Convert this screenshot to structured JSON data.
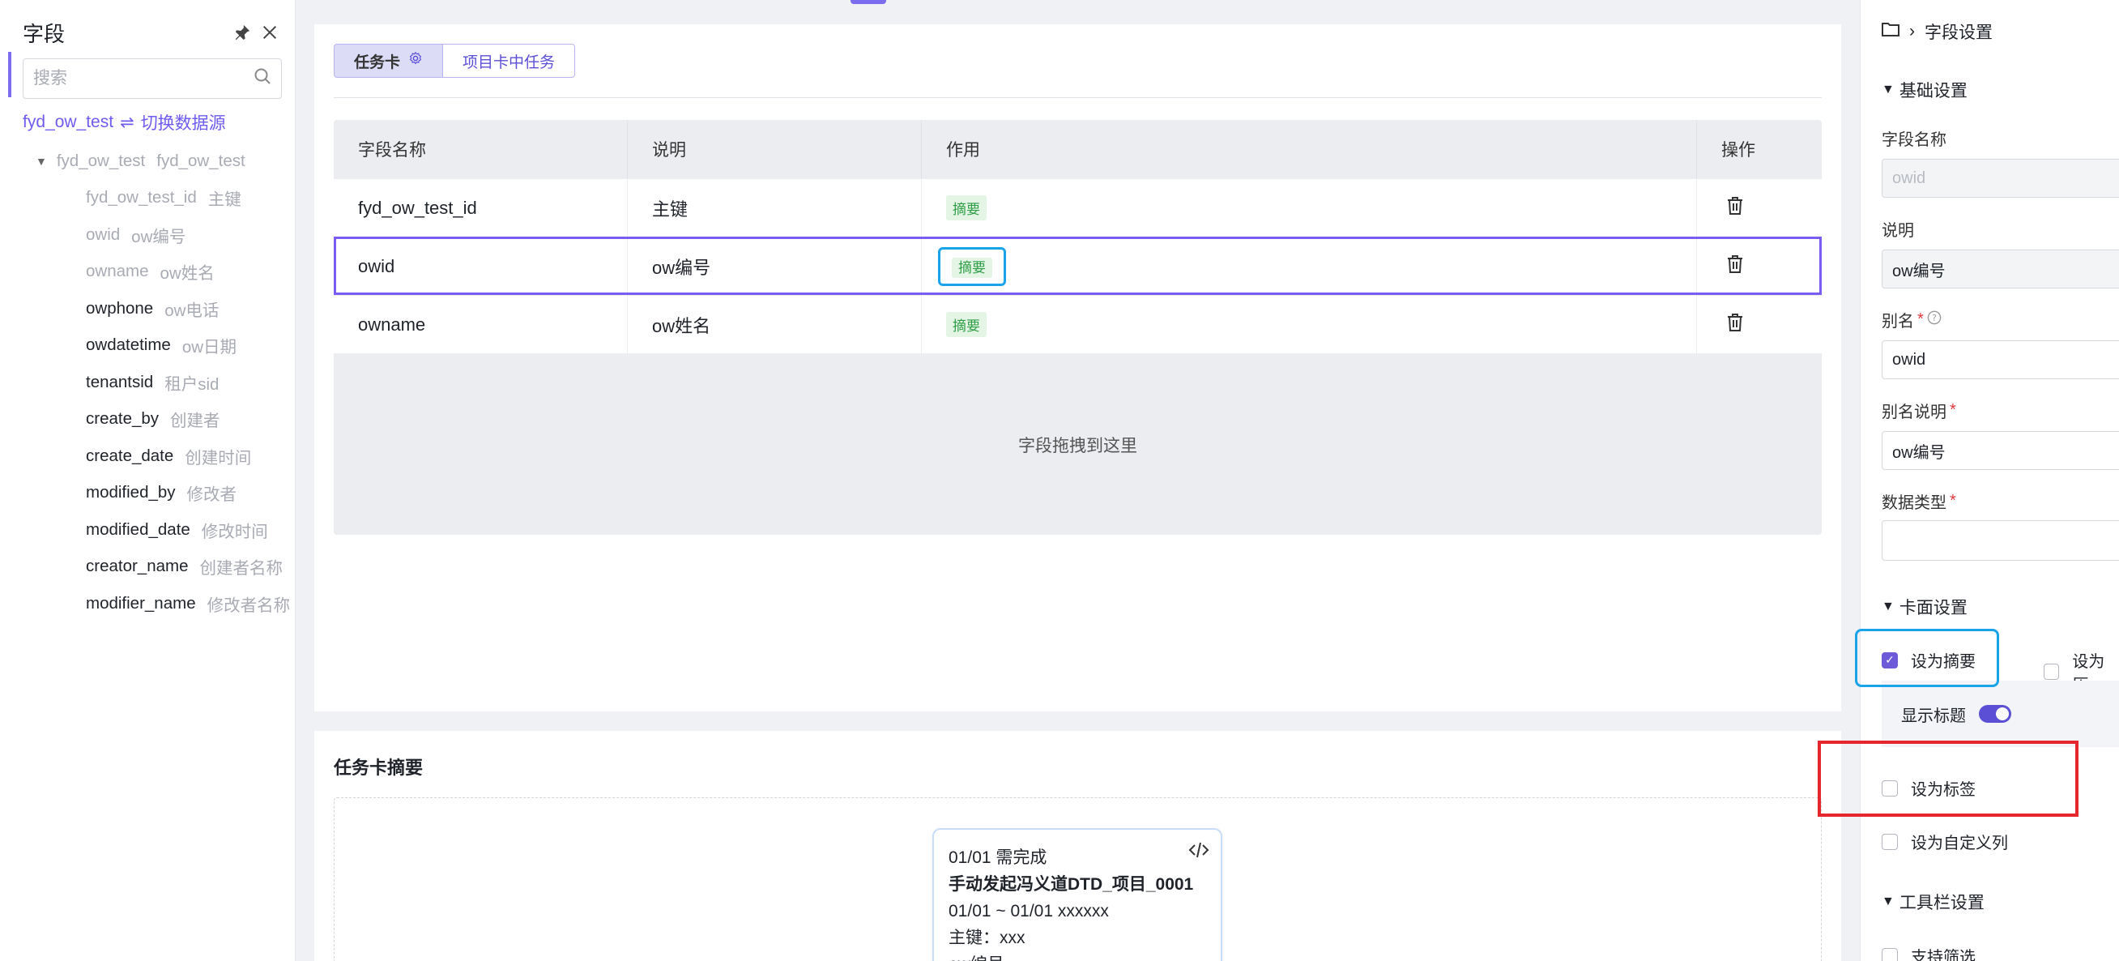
{
  "left_panel": {
    "title": "字段",
    "search_placeholder": "搜索",
    "datasource": {
      "name": "fyd_ow_test",
      "switch_label": "切换数据源"
    },
    "tree": {
      "root": {
        "name": "fyd_ow_test",
        "desc": "fyd_ow_test"
      },
      "items": [
        {
          "name": "fyd_ow_test_id",
          "desc": "主键"
        },
        {
          "name": "owid",
          "desc": "ow编号"
        },
        {
          "name": "owname",
          "desc": "ow姓名"
        },
        {
          "name": "owphone",
          "desc": "ow电话"
        },
        {
          "name": "owdatetime",
          "desc": "ow日期"
        },
        {
          "name": "tenantsid",
          "desc": "租户sid"
        },
        {
          "name": "create_by",
          "desc": "创建者"
        },
        {
          "name": "create_date",
          "desc": "创建时间"
        },
        {
          "name": "modified_by",
          "desc": "修改者"
        },
        {
          "name": "modified_date",
          "desc": "修改时间"
        },
        {
          "name": "creator_name",
          "desc": "创建者名称"
        },
        {
          "name": "modifier_name",
          "desc": "修改者名称"
        }
      ]
    }
  },
  "main": {
    "tabs": [
      {
        "label": "任务卡"
      },
      {
        "label": "项目卡中任务"
      }
    ],
    "table": {
      "headers": [
        "字段名称",
        "说明",
        "作用",
        "操作"
      ],
      "rows": [
        {
          "name": "fyd_ow_test_id",
          "desc": "主键",
          "role": "摘要"
        },
        {
          "name": "owid",
          "desc": "ow编号",
          "role": "摘要"
        },
        {
          "name": "owname",
          "desc": "ow姓名",
          "role": "摘要"
        }
      ],
      "drop_hint": "字段拖拽到这里"
    },
    "summary": {
      "title": "任务卡摘要",
      "preview": {
        "line1": "01/01 需完成",
        "line2": "手动发起冯义道DTD_项目_0001",
        "line3": "01/01 ~ 01/01 xxxxxx",
        "line4": "主键：xxx",
        "line5": "ow编号"
      }
    }
  },
  "right_panel": {
    "breadcrumb": "字段设置",
    "basic_section": "基础设置",
    "field_name_label": "字段名称",
    "field_name_value": "owid",
    "desc_label": "说明",
    "desc_value": "ow编号",
    "alias_label": "别名",
    "alias_value": "owid",
    "alias_desc_label": "别名说明",
    "alias_desc_value": "ow编号",
    "data_type_label": "数据类型",
    "data_type_value": "",
    "card_section": "卡面设置",
    "set_summary": "设为摘要",
    "set_history": "设为历",
    "show_title": "显示标题",
    "set_tag": "设为标签",
    "set_custom_col": "设为自定义列",
    "toolbar_section": "工具栏设置",
    "support_filter": "支持筛选"
  }
}
